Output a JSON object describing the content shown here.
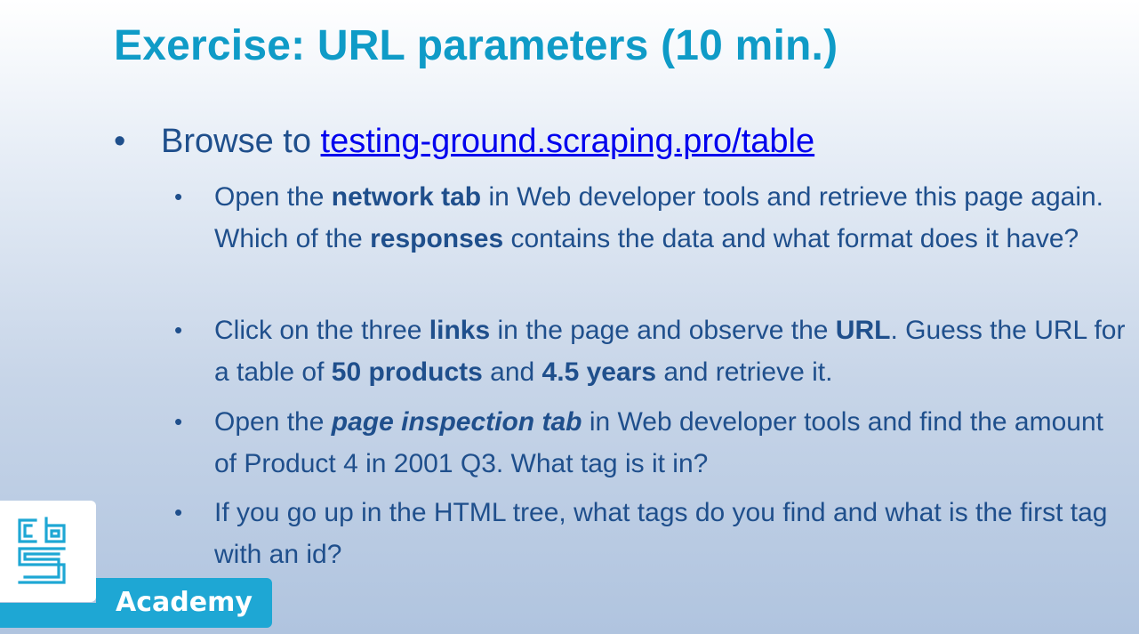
{
  "slide": {
    "title": "Exercise: URL parameters (10 min.)"
  },
  "bullets": {
    "main": {
      "prefix": "Browse to ",
      "link": "testing-ground.scraping.pro/table"
    },
    "sub1": {
      "t1": "Open the ",
      "b1": "network tab",
      "t2": " in Web developer tools and retrieve this page again. Which of the ",
      "b2": "responses",
      "t3": " contains the data and what format does it have?"
    },
    "sub2": {
      "t1": "Click on the three ",
      "b1": "links",
      "t2": " in the page and observe the ",
      "b2": "URL",
      "t3": ". Guess the URL for a table of ",
      "b3": "50 products",
      "t4": " and ",
      "b4": "4.5 years",
      "t5": " and retrieve it."
    },
    "sub3": {
      "t1": "Open the ",
      "bi1": "page inspection tab",
      "t2": " in Web developer tools and find the amount of Product 4 in 2001 Q3. What tag is it in?"
    },
    "sub4": {
      "t1": "If you go up in the HTML tree, what tags do you find and what is the first tag with an id?"
    },
    "bullet_char": "•"
  },
  "branding": {
    "logo_icon": "cbs-logo-icon",
    "academy_label": "Academy",
    "accent_color": "#1ea7d4",
    "title_color": "#0f9bc7",
    "text_color": "#1f4f8c"
  }
}
